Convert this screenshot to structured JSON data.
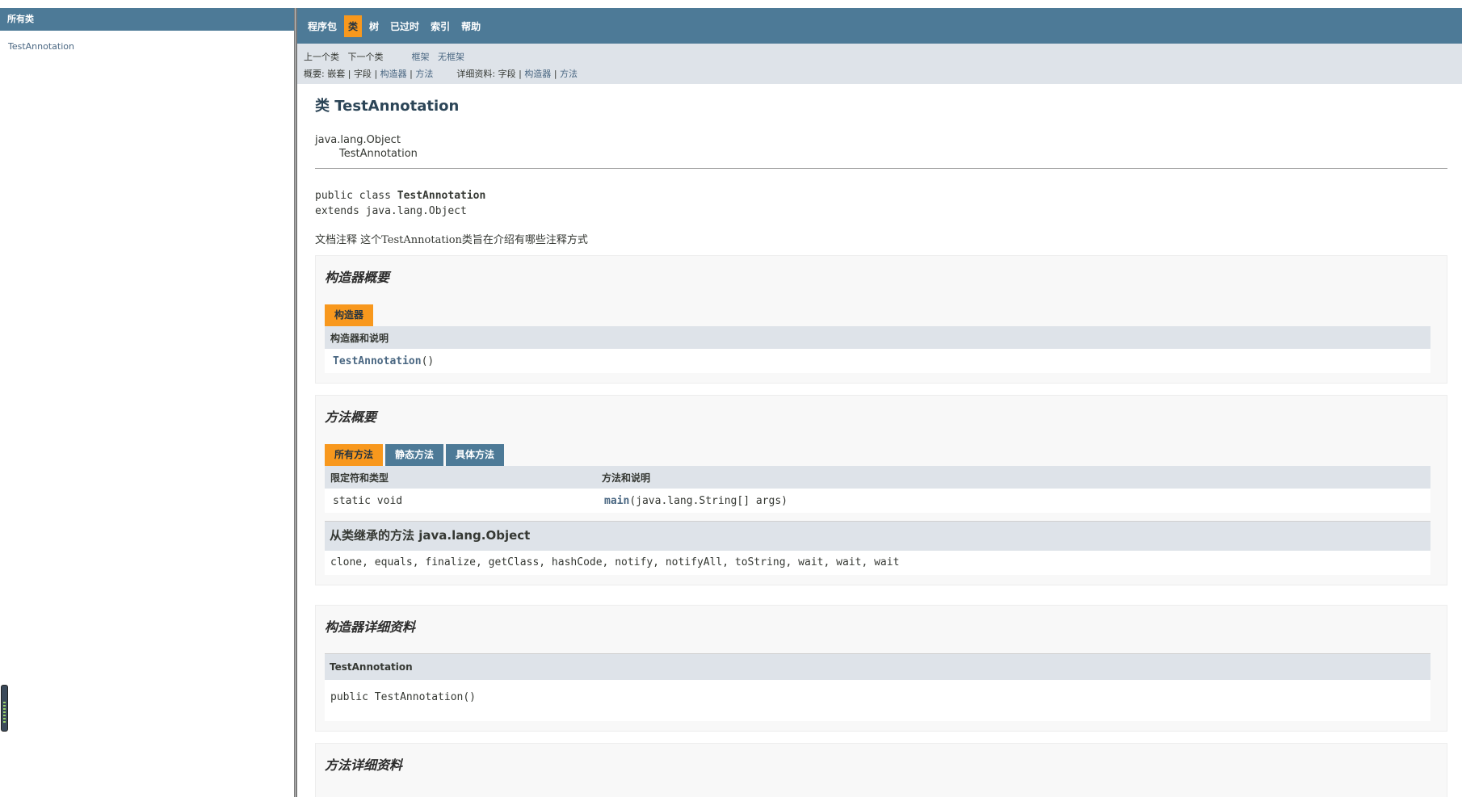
{
  "left_frame": {
    "header": "所有类",
    "items": [
      "TestAnnotation"
    ]
  },
  "nav": {
    "items": [
      "程序包",
      "类",
      "树",
      "已过时",
      "索引",
      "帮助"
    ],
    "active": "类",
    "prev_class": "上一个类",
    "next_class": "下一个类",
    "frames": "框架",
    "no_frames": "无框架",
    "summary_label": "概要:",
    "summary_nested": "嵌套",
    "summary_field": "字段",
    "summary_constructor": "构造器",
    "summary_method": "方法",
    "detail_label": "详细资料:",
    "detail_field": "字段",
    "detail_constructor": "构造器",
    "detail_method": "方法",
    "separator": "|"
  },
  "page": {
    "title": "类 TestAnnotation",
    "inheritance_parent": "java.lang.Object",
    "inheritance_child": "TestAnnotation",
    "signature_prefix": "public class ",
    "signature_name": "TestAnnotation",
    "signature_extends": "extends java.lang.Object",
    "doc_comment": "文档注释 这个TestAnnotation类旨在介绍有哪些注释方式"
  },
  "constructor_summary": {
    "title": "构造器概要",
    "tab": "构造器",
    "column": "构造器和说明",
    "rows": [
      {
        "name": "TestAnnotation",
        "args": "()"
      }
    ]
  },
  "method_summary": {
    "title": "方法概要",
    "tabs": [
      "所有方法",
      "静态方法",
      "具体方法"
    ],
    "columns": [
      "限定符和类型",
      "方法和说明"
    ],
    "rows": [
      {
        "type": "static void",
        "name": "main",
        "args": "(java.lang.String[] args)"
      }
    ],
    "inherited_title": "从类继承的方法 java.lang.Object",
    "inherited_methods": "clone, equals, finalize, getClass, hashCode, notify, notifyAll, toString, wait, wait, wait"
  },
  "constructor_detail": {
    "title": "构造器详细资料",
    "name": "TestAnnotation",
    "signature": "public TestAnnotation()"
  },
  "method_detail": {
    "title": "方法详细资料"
  }
}
